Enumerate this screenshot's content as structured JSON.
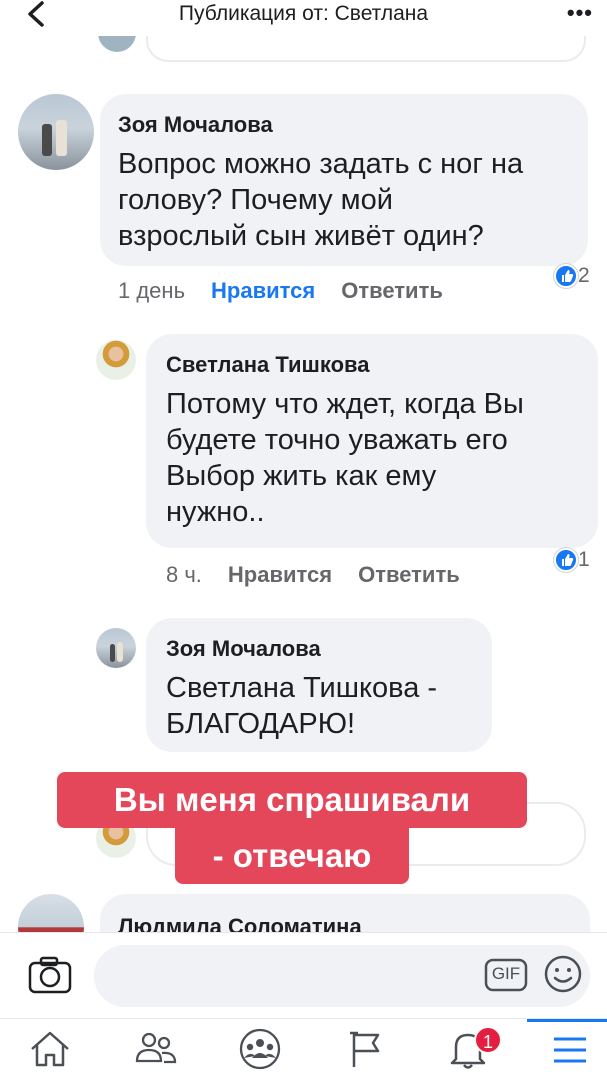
{
  "header": {
    "title": "Публикация от: Светлана",
    "more_label": "•••"
  },
  "comments": [
    {
      "author": "Зоя Мочалова",
      "text_lines": [
        "Вопрос можно задать с ног на",
        "голову? Почему мой",
        "взрослый сын живёт один?"
      ],
      "time": "1 день",
      "like_label": "Нравится",
      "reply_label": "Ответить",
      "reactions": "2"
    },
    {
      "author": "Светлана Тишкова",
      "text_lines": [
        "Потому что ждет, когда Вы",
        "будете точно уважать его",
        "Выбор жить как ему",
        "нужно.."
      ],
      "time": "8 ч.",
      "like_label": "Нравится",
      "reply_label": "Ответить",
      "reactions": "1"
    },
    {
      "author": "Зоя Мочалова",
      "text_lines": [
        "Светлана Тишкова -",
        "БЛАГОДАРЮ!"
      ]
    },
    {
      "author": "Людмила Соломатина"
    }
  ],
  "sticker": {
    "line1": "Вы меня спрашивали",
    "line2": "- отвечаю"
  },
  "composer": {
    "gif_label": "GIF"
  },
  "tabbar": {
    "notifications_badge": "1"
  },
  "colors": {
    "accent": "#1877f2",
    "sticker": "#e5475a",
    "badge": "#e41e3f"
  }
}
